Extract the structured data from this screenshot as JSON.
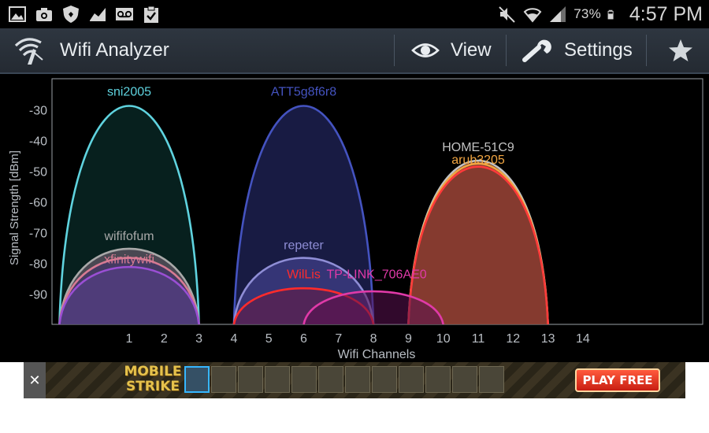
{
  "status_bar": {
    "battery_percent": "73%",
    "time": "4:57 PM",
    "icons": [
      "gallery-icon",
      "camera-icon",
      "shield-icon",
      "chart-icon",
      "voicemail-icon",
      "clipboard-icon",
      "mute-icon",
      "wifi-icon",
      "signal-icon",
      "battery-icon"
    ]
  },
  "action_bar": {
    "title": "Wifi Analyzer",
    "view_label": "View",
    "settings_label": "Settings",
    "icons": [
      "wifi-antenna-icon",
      "eye-icon",
      "wrench-icon",
      "star-icon"
    ]
  },
  "chart_data": {
    "type": "area",
    "xlabel": "Wifi Channels",
    "ylabel": "Signal Strength [dBm]",
    "ylim": [
      -100,
      -20
    ],
    "yticks": [
      -30,
      -40,
      -50,
      -60,
      -70,
      -80,
      -90
    ],
    "xticks": [
      1,
      2,
      3,
      4,
      5,
      6,
      7,
      8,
      9,
      10,
      11,
      12,
      13,
      14
    ],
    "grid": false,
    "networks": [
      {
        "name": "sni2005",
        "channel": 1,
        "signal": -28,
        "color": "#5fd3df",
        "fill": "#0d3a36"
      },
      {
        "name": "wififofum",
        "channel": 1,
        "signal": -75,
        "color": "#a9a9a9",
        "fill": "#7f6a7e"
      },
      {
        "name": "xfinitywifi",
        "channel": 1,
        "signal": -78,
        "color": "#d77b93",
        "fill": "#3f3070"
      },
      {
        "name": "",
        "channel": 1,
        "signal": -81,
        "color": "#9a4fd4",
        "fill": "#5a3e8c"
      },
      {
        "name": "ATT5g8f6r8",
        "channel": 6,
        "signal": -28,
        "color": "#4453c0",
        "fill": "#2c317a"
      },
      {
        "name": "repeter",
        "channel": 6,
        "signal": -78,
        "color": "#8f8ed6",
        "fill": "#4e4aa0"
      },
      {
        "name": "WilLis",
        "channel": 6,
        "signal": -88,
        "color": "#ff2b2b",
        "fill": "#6a1740"
      },
      {
        "name": "TP-LINK_706AE0",
        "channel": 8,
        "signal": -89,
        "color": "#e03aa8",
        "fill": "#5a1050"
      },
      {
        "name": "HOME-51C9",
        "channel": 11,
        "signal": -46,
        "color": "#c2c2c2",
        "fill": "#a04a3c"
      },
      {
        "name": "arub3205",
        "channel": 11,
        "signal": -47,
        "color": "#f1a542",
        "fill": "#a04a3c"
      },
      {
        "name": "",
        "channel": 11,
        "signal": -48,
        "color": "#ff3a3a",
        "fill": "#8a3a30"
      }
    ]
  },
  "ad": {
    "close_label": "✕",
    "logo_line1": "MOBILE",
    "logo_line2": "STRIKE",
    "cta": "PLAY FREE"
  }
}
